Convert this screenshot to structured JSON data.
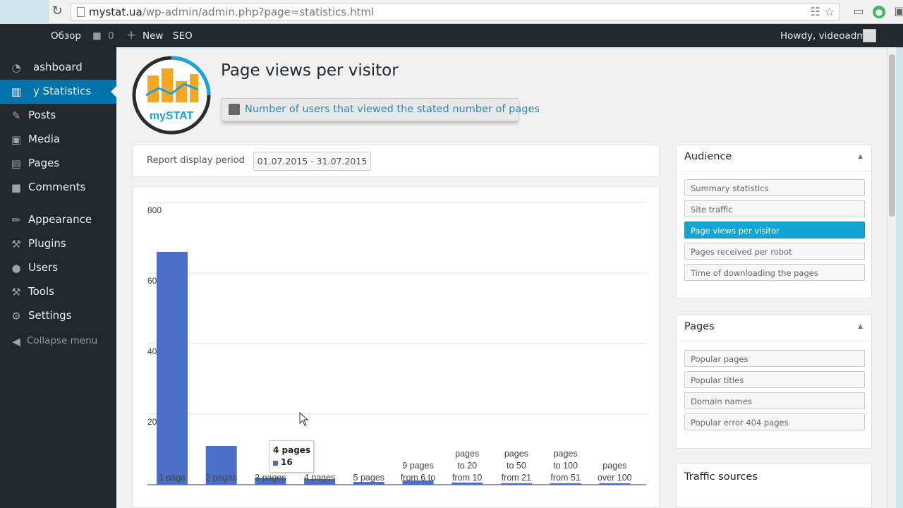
{
  "browser": {
    "url_host": "mystat.ua",
    "url_path": "/wp-admin/admin.php?page=statistics.html"
  },
  "adminbar": {
    "site_name": "Обзор",
    "comments_count": "0",
    "new_label": "New",
    "seo_label": "SEO",
    "howdy": "Howdy, videoadmin"
  },
  "sidebar": {
    "items": [
      {
        "label": "ashboard",
        "icon": "dashboard-icon"
      },
      {
        "label": "y Statistics",
        "icon": "statistics-icon",
        "active": true
      },
      {
        "label": "Posts",
        "icon": "posts-icon"
      },
      {
        "label": "Media",
        "icon": "media-icon"
      },
      {
        "label": "Pages",
        "icon": "pages-icon"
      },
      {
        "label": "Comments",
        "icon": "comments-icon"
      },
      {
        "label": "Appearance",
        "icon": "appearance-icon"
      },
      {
        "label": "Plugins",
        "icon": "plugins-icon"
      },
      {
        "label": "Users",
        "icon": "users-icon"
      },
      {
        "label": "Tools",
        "icon": "tools-icon"
      },
      {
        "label": "Settings",
        "icon": "settings-icon"
      }
    ],
    "collapse_label": "Collapse menu"
  },
  "main": {
    "logo_text": "mySTAT",
    "title": "Page views per visitor",
    "subtitle": "Number of users that viewed the stated number of pages",
    "period_label": "Report display period",
    "period_value": "01.07.2015 - 31.07.2015"
  },
  "tooltip": {
    "title": "4 pages",
    "value": "16"
  },
  "chart_data": {
    "type": "bar",
    "categories": [
      "1 page",
      "2 pages",
      "3 pages",
      "4 pages",
      "5 pages",
      "from 6 to 9 pages",
      "from 10 to 20 pages",
      "from 21 to 50 pages",
      "from 51 to 100 pages",
      "over 100 pages"
    ],
    "label_lines": [
      [
        "1 page"
      ],
      [
        "2 pages"
      ],
      [
        "3 pages"
      ],
      [
        "4 pages"
      ],
      [
        "5 pages"
      ],
      [
        "9 pages",
        "from 6 to"
      ],
      [
        "pages",
        "to 20",
        "from 10"
      ],
      [
        "pages",
        "to 50",
        "from 21"
      ],
      [
        "pages",
        "to 100",
        "from 51"
      ],
      [
        "pages",
        "over 100"
      ]
    ],
    "values": [
      660,
      110,
      20,
      16,
      8,
      12,
      6,
      4,
      2,
      1
    ],
    "ylim": [
      0,
      800
    ],
    "yticks": [
      200,
      400,
      600,
      800
    ],
    "grid": true,
    "bar_color": "#4a6fc8"
  },
  "widgets": {
    "audience": {
      "title": "Audience",
      "items": [
        "Summary statistics",
        "Site traffic",
        "Page views per visitor",
        "Pages received per robot",
        "Time of downloading the pages"
      ],
      "active_index": 2
    },
    "pages": {
      "title": "Pages",
      "items": [
        "Popular pages",
        "Popular titles",
        "Domain names",
        "Popular error 404 pages"
      ]
    },
    "traffic": {
      "title": "Traffic sources"
    }
  },
  "colors": {
    "admin_dark": "#23282d",
    "accent_blue": "#0073aa",
    "active_button": "#12a5d3",
    "bar": "#4a6fc8"
  }
}
